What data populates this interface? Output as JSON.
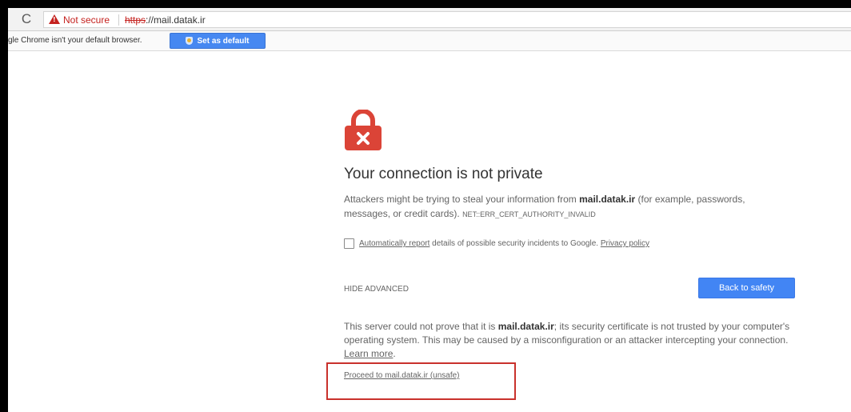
{
  "toolbar": {
    "reload_glyph": "C",
    "security_label": "Not secure",
    "url_scheme": "https",
    "url_rest": "://mail.datak.ir"
  },
  "infobar": {
    "message": "gle Chrome isn't your default browser.",
    "button_label": "Set as default"
  },
  "interstitial": {
    "heading": "Your connection is not private",
    "p1_before": "Attackers might be trying to steal your information from ",
    "p1_host": "mail.datak.ir",
    "p1_after": " (for example, passwords, messages, or credit cards).",
    "error_code": "NET::ERR_CERT_AUTHORITY_INVALID",
    "checkbox_link": "Automatically report",
    "checkbox_text": " details of possible security incidents to Google. ",
    "privacy_link": "Privacy policy",
    "hide_advanced": "HIDE ADVANCED",
    "back_button": "Back to safety",
    "p2_before": "This server could not prove that it is ",
    "p2_host": "mail.datak.ir",
    "p2_after": "; its security certificate is not trusted by your computer's operating system. This may be caused by a misconfiguration or an attacker intercepting your connection. ",
    "learn_more": "Learn more",
    "p2_end": ".",
    "proceed_link": "Proceed to mail.datak.ir (unsafe)"
  },
  "colors": {
    "danger": "#c5221f",
    "lock": "#db4437",
    "button_blue": "#4285f4",
    "highlight_box": "#c9312c"
  },
  "icons": {
    "reload": "reload-icon",
    "warning": "warning-triangle-icon",
    "lock": "broken-lock-icon",
    "shield": "shield-icon"
  }
}
